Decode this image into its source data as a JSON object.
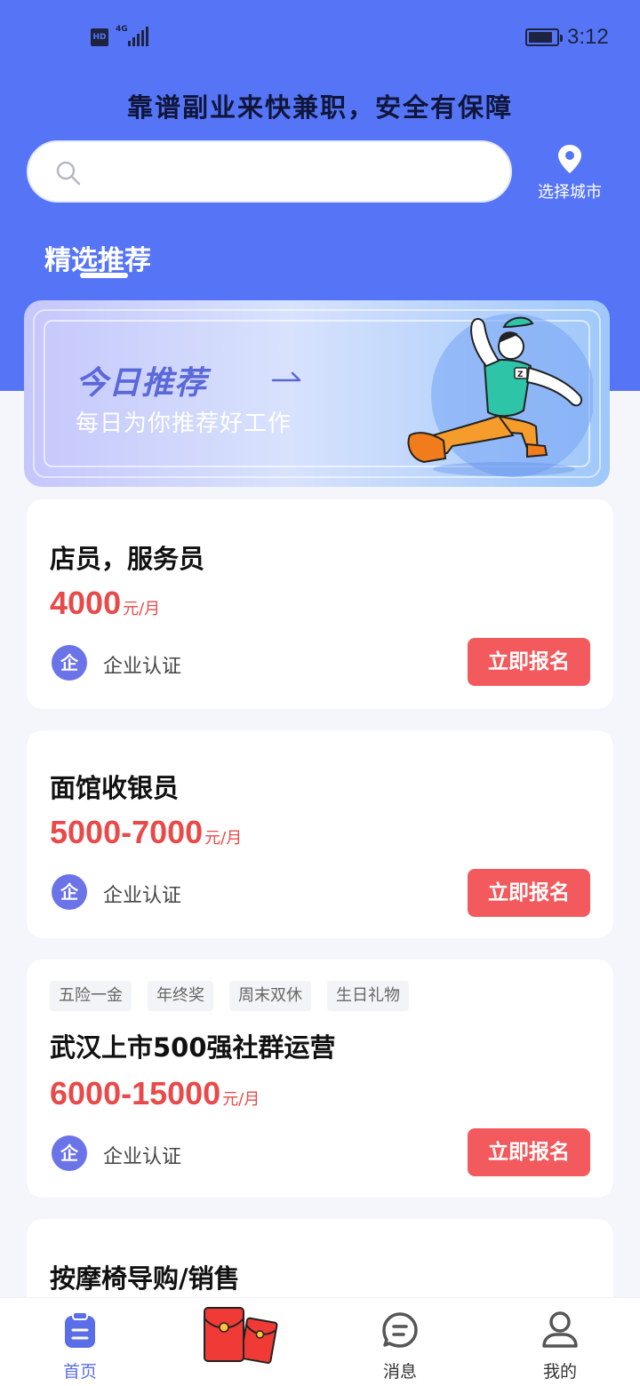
{
  "status_bar": {
    "hd": "HD",
    "network": "4G",
    "time": "3:12"
  },
  "header": {
    "slogan": "靠谱副业来快兼职，安全有保障",
    "search_placeholder": "",
    "city_label": "选择城市",
    "selected_tab": "精选推荐"
  },
  "banner": {
    "title": "今日推荐",
    "subtitle": "每日为你推荐好工作"
  },
  "jobs": [
    {
      "tags": [],
      "title": "店员，服务员",
      "salary": "4000",
      "unit": "元/月",
      "badge": "企",
      "auth": "企业认证",
      "apply": "立即报名"
    },
    {
      "tags": [],
      "title": "面馆收银员",
      "salary": "5000-7000",
      "unit": "元/月",
      "badge": "企",
      "auth": "企业认证",
      "apply": "立即报名"
    },
    {
      "tags": [
        "五险一金",
        "年终奖",
        "周末双休",
        "生日礼物"
      ],
      "title": "武汉上市500强社群运营",
      "salary": "6000-15000",
      "unit": "元/月",
      "badge": "企",
      "auth": "企业认证",
      "apply": "立即报名"
    },
    {
      "tags": [],
      "title": "按摩椅导购/销售"
    }
  ],
  "tabbar": {
    "home": "首页",
    "messages": "消息",
    "mine": "我的"
  },
  "colors": {
    "primary": "#5575f6",
    "salary": "#e84a4a",
    "apply_button": "#f25a5d",
    "badge": "#6b73e8"
  }
}
